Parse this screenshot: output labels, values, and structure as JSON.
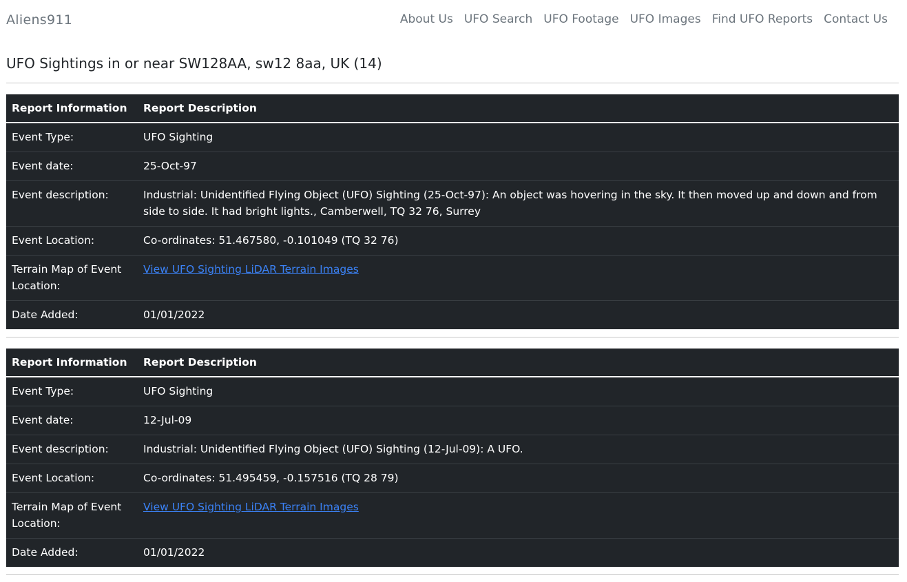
{
  "nav": {
    "brand": "Aliens911",
    "links": [
      "About Us",
      "UFO Search",
      "UFO Footage",
      "UFO Images",
      "Find UFO Reports",
      "Contact Us"
    ]
  },
  "page_title": "UFO Sightings in or near SW128AA, sw12 8aa, UK (14)",
  "reports": [
    {
      "header_info": "Report Information",
      "header_desc": "Report Description",
      "rows": [
        {
          "label": "Event Type:",
          "value": "UFO Sighting"
        },
        {
          "label": "Event date:",
          "value": "25-Oct-97"
        },
        {
          "label": "Event description:",
          "value": "Industrial: Unidentified Flying Object (UFO) Sighting (25-Oct-97): An object was hovering in the sky. It then moved up and down and from side to side. It had bright lights., Camberwell, TQ 32 76, Surrey"
        },
        {
          "label": "Event Location:",
          "value": "Co-ordinates: 51.467580, -0.101049 (TQ 32 76)"
        },
        {
          "label": "Terrain Map of Event Location:",
          "value": "View UFO Sighting LiDAR Terrain Images"
        },
        {
          "label": "Date Added:",
          "value": "01/01/2022"
        }
      ]
    },
    {
      "header_info": "Report Information",
      "header_desc": "Report Description",
      "rows": [
        {
          "label": "Event Type:",
          "value": "UFO Sighting"
        },
        {
          "label": "Event date:",
          "value": "12-Jul-09"
        },
        {
          "label": "Event description:",
          "value": "Industrial: Unidentified Flying Object (UFO) Sighting (12-Jul-09): A UFO."
        },
        {
          "label": "Event Location:",
          "value": "Co-ordinates: 51.495459, -0.157516 (TQ 28 79)"
        },
        {
          "label": "Terrain Map of Event Location:",
          "value": "View UFO Sighting LiDAR Terrain Images"
        },
        {
          "label": "Date Added:",
          "value": "01/01/2022"
        }
      ]
    }
  ],
  "colors": {
    "table_bg": "#212529",
    "link": "#3b82f6",
    "nav_text": "#6c757d"
  }
}
